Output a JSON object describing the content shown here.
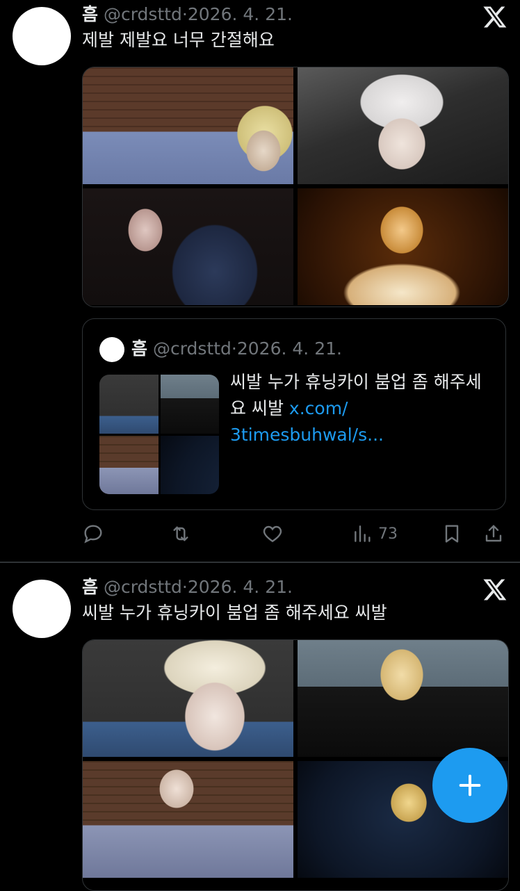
{
  "tweets": [
    {
      "name": "흠",
      "handle": "@crdsttd",
      "separator": "·",
      "date": "2026. 4. 21.",
      "text": "제발 제발요 너무 간절해요",
      "images": [
        "photo-1",
        "photo-2",
        "photo-3",
        "photo-4"
      ],
      "quote": {
        "name": "흠",
        "handle": "@crdsttd",
        "separator": "·",
        "date": "2026. 4. 21.",
        "text": "씨발 누가 휴닝카이 붐업 좀 해주세요 씨발",
        "link_line1": "x.com/",
        "link_line2": "3timesbuhwal/s..."
      },
      "actions": {
        "reply_icon": "reply-icon",
        "retweet_icon": "retweet-icon",
        "like_icon": "heart-icon",
        "views_icon": "views-icon",
        "views_count": "73",
        "bookmark_icon": "bookmark-icon",
        "share_icon": "share-icon"
      }
    },
    {
      "name": "흠",
      "handle": "@crdsttd",
      "separator": "·",
      "date": "2026. 4. 21.",
      "text": "씨발 누가 휴닝카이 붐업 좀 해주세요 씨발",
      "images": [
        "photo-1",
        "photo-2",
        "photo-3",
        "photo-4"
      ]
    }
  ],
  "fab": {
    "icon": "plus-icon"
  },
  "colors": {
    "background": "#000000",
    "text": "#e7e9ea",
    "muted": "#71767b",
    "accent": "#1d9bf0",
    "border": "#2f3336"
  }
}
